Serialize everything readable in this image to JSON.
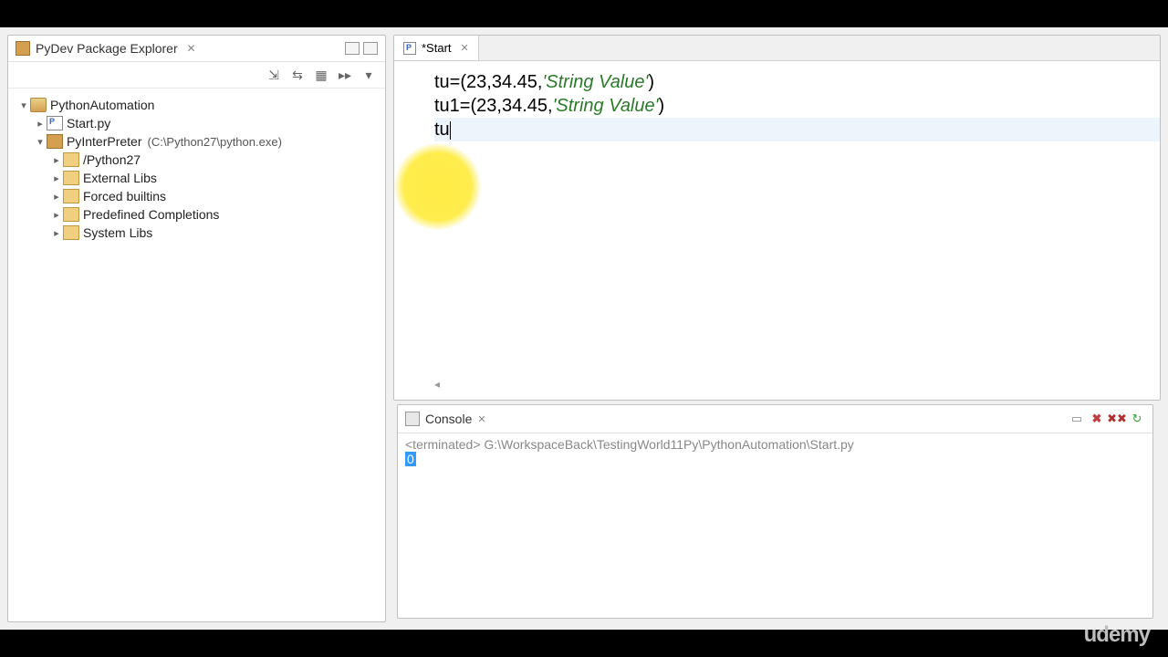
{
  "sidebar": {
    "title": "PyDev Package Explorer",
    "tree": {
      "project": "PythonAutomation",
      "file": "Start.py",
      "interpreter_label": "PyInterPreter",
      "interpreter_path": "(C:\\Python27\\python.exe)",
      "libs": [
        "/Python27",
        "External Libs",
        "Forced builtins",
        "Predefined Completions",
        "System Libs"
      ]
    }
  },
  "editor": {
    "tab_label": "*Start",
    "code": {
      "line1_a": "tu=(",
      "line1_b": "23",
      "line1_c": ",",
      "line1_d": "34.45",
      "line1_e": ",",
      "line1_f": "'String Value'",
      "line1_g": ")",
      "line2_a": "tu1=(",
      "line2_b": "23",
      "line2_c": ",",
      "line2_d": "34.45",
      "line2_e": ",",
      "line2_f": "'String Value'",
      "line2_g": ")",
      "line3": "tu"
    }
  },
  "console": {
    "title": "Console",
    "status_prefix": "<terminated>",
    "status_path": "G:\\WorkspaceBack\\TestingWorld11Py\\PythonAutomation\\Start.py",
    "output": "0"
  },
  "watermark": "udemy"
}
